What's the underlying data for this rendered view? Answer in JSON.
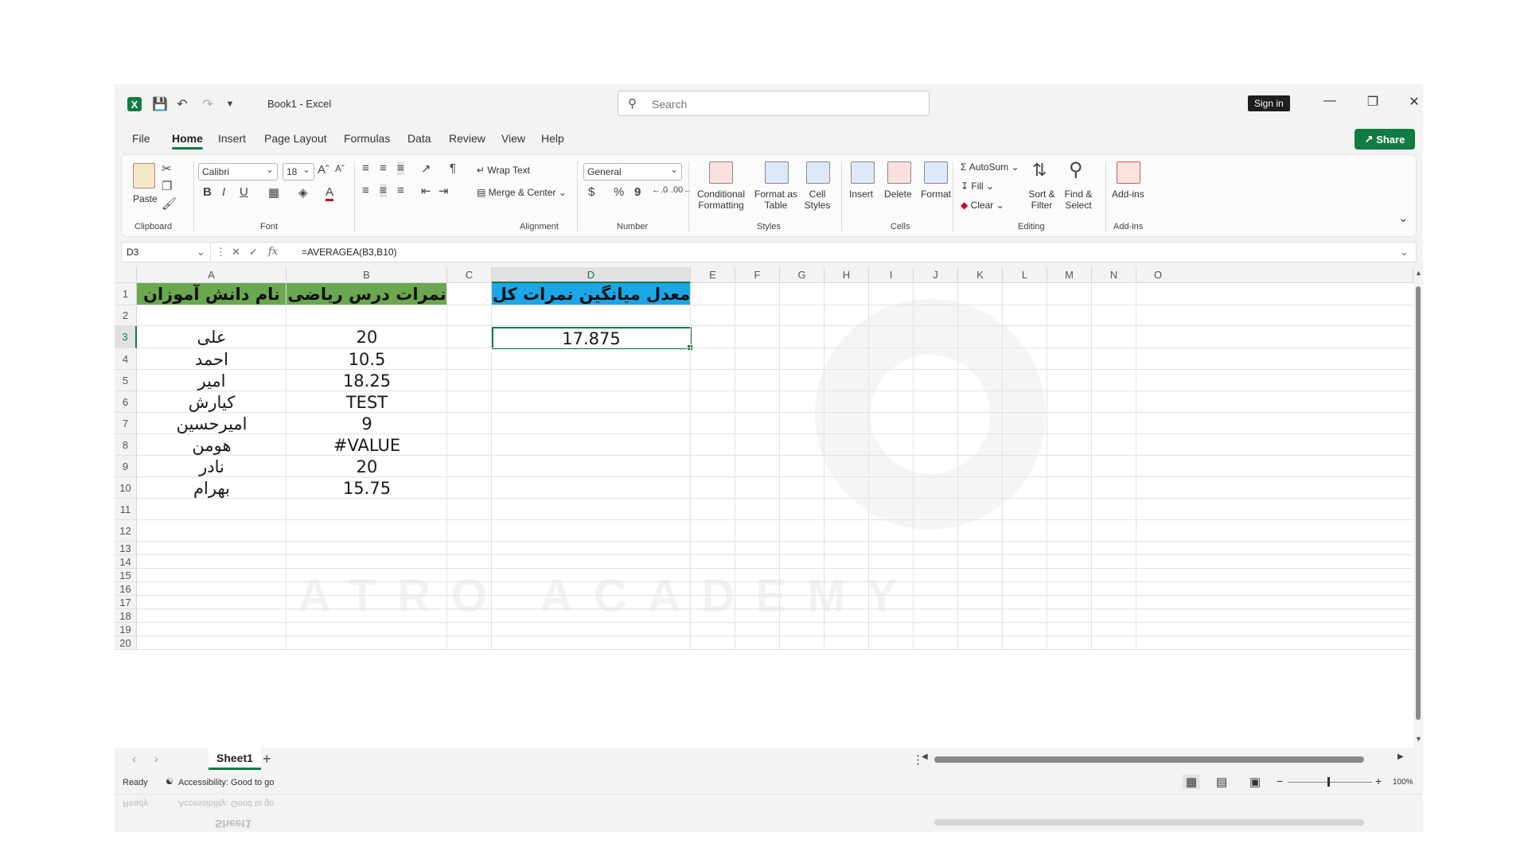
{
  "window": {
    "title": "Book1 - Excel",
    "search_placeholder": "Search",
    "signin": "Sign in",
    "share": "Share"
  },
  "tabs": [
    "File",
    "Home",
    "Insert",
    "Page Layout",
    "Formulas",
    "Data",
    "Review",
    "View",
    "Help"
  ],
  "ribbon": {
    "clipboard": {
      "paste": "Paste",
      "label": "Clipboard"
    },
    "font": {
      "name": "Calibri",
      "size": "18",
      "bold": "B",
      "italic": "I",
      "underline": "U",
      "label": "Font"
    },
    "alignment": {
      "wrap": "Wrap Text",
      "merge": "Merge & Center",
      "label": "Alignment"
    },
    "number": {
      "format": "General",
      "dollar": "$",
      "percent": "%",
      "comma": "9",
      "label": "Number"
    },
    "styles": {
      "conditional": "Conditional",
      "conditional2": "Formatting",
      "format_table": "Format as",
      "format_table2": "Table",
      "cell_styles": "Cell",
      "cell_styles2": "Styles",
      "label": "Styles"
    },
    "cells": {
      "insert": "Insert",
      "delete": "Delete",
      "format": "Format",
      "label": "Cells"
    },
    "editing": {
      "autosum": "AutoSum",
      "fill": "Fill",
      "clear": "Clear",
      "sort": "Sort &",
      "sort2": "Filter",
      "find": "Find &",
      "find2": "Select",
      "label": "Editing"
    },
    "addins": {
      "addins": "Add-ins",
      "label": "Add-ins"
    }
  },
  "formula_bar": {
    "name_box": "D3",
    "formula": "=AVERAGEA(B3,B10)",
    "fx": "fx"
  },
  "columns": [
    "A",
    "B",
    "C",
    "D",
    "E",
    "F",
    "G",
    "H",
    "I",
    "J",
    "K",
    "L",
    "M",
    "N",
    "O"
  ],
  "rows": [
    "1",
    "2",
    "3",
    "4",
    "5",
    "6",
    "7",
    "8",
    "9",
    "10",
    "11",
    "12",
    "13",
    "14",
    "15",
    "16",
    "17",
    "18",
    "19",
    "20"
  ],
  "cells": {
    "A1": "نام دانش آموزان",
    "B1": "نمرات درس ریاضی",
    "D1": "معدل میانگین نمرات کل",
    "D3": "17.875",
    "names": [
      "علی",
      "احمد",
      "امیر",
      "کیارش",
      "امیرحسین",
      "هومن",
      "نادر",
      "بهرام"
    ],
    "scores": [
      "20",
      "10.5",
      "18.25",
      "TEST",
      "9",
      "#VALUE",
      "20",
      "15.75"
    ]
  },
  "watermark": "ATRO ACADEMY",
  "sheet_tab": "Sheet1",
  "status": {
    "ready": "Ready",
    "accessibility": "Accessibility: Good to go",
    "zoom": "100%"
  },
  "colors": {
    "excel_green": "#107c41",
    "a1_fill": "#6aa84f",
    "d1_fill": "#1ba6ea"
  }
}
